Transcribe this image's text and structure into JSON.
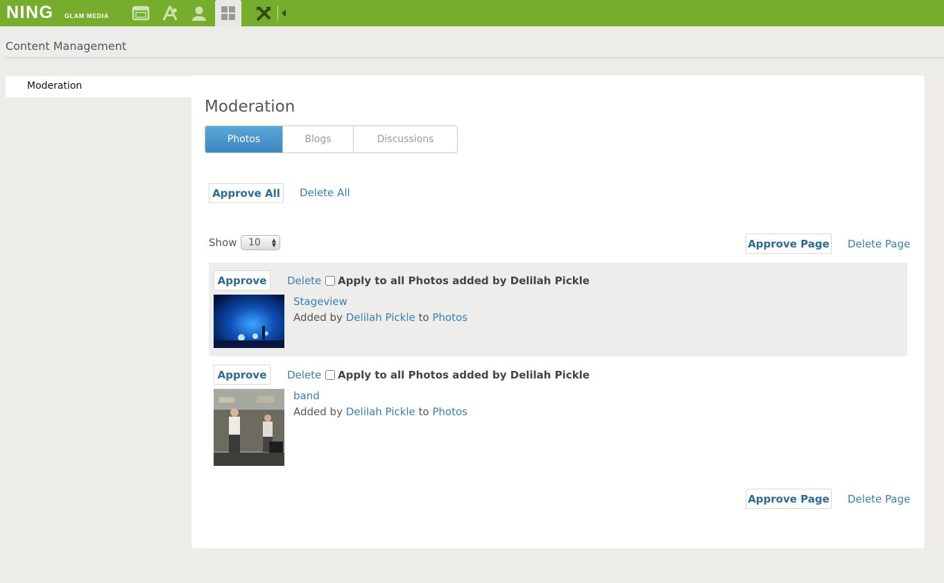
{
  "topbar": {
    "logo": "NING",
    "logo_sub": "GLAM MEDIA",
    "icons": [
      "browser-window-icon",
      "appearance-icon",
      "person-icon",
      "grid-icon",
      "tools-icon",
      "collapse-arrow-icon"
    ],
    "accent_color": "#77ad2c"
  },
  "page": {
    "title": "Content Management"
  },
  "sidebar": {
    "items": [
      {
        "label": "Moderation"
      }
    ]
  },
  "main": {
    "title": "Moderation",
    "tabs": [
      {
        "label": "Photos",
        "active": true
      },
      {
        "label": "Blogs",
        "active": false
      },
      {
        "label": "Discussions",
        "active": false
      }
    ],
    "approve_all": "Approve All",
    "delete_all": "Delete All",
    "show_label": "Show",
    "show_value": "10",
    "approve_page": "Approve Page",
    "delete_page": "Delete Page",
    "items": [
      {
        "approve": "Approve",
        "delete": "Delete",
        "apply_text": "Apply to all Photos added by Delilah Pickle",
        "title": "Stageview",
        "added_by_prefix": "Added by",
        "author": "Delilah Pickle",
        "to_word": "to",
        "destination": "Photos"
      },
      {
        "approve": "Approve",
        "delete": "Delete",
        "apply_text": "Apply to all Photos added by Delilah Pickle",
        "title": "band",
        "added_by_prefix": "Added by",
        "author": "Delilah Pickle",
        "to_word": "to",
        "destination": "Photos"
      }
    ]
  }
}
